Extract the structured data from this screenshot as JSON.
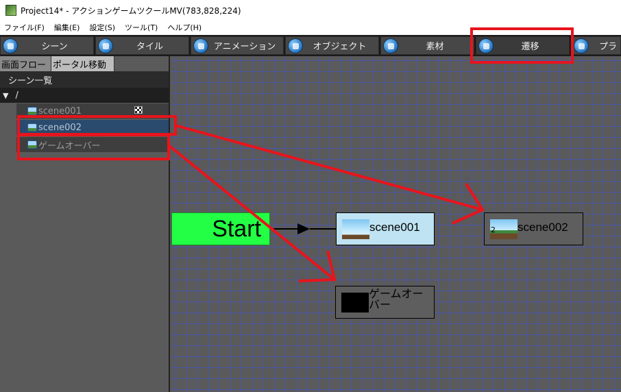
{
  "window": {
    "title": "Project14* - アクションゲームツクールMV(783,828,224)"
  },
  "menu": [
    "ファイル(F)",
    "編集(E)",
    "設定(S)",
    "ツール(T)",
    "ヘルプ(H)"
  ],
  "tabs": [
    {
      "label": "シーン",
      "icon": "scene-icon"
    },
    {
      "label": "タイル",
      "icon": "tile-icon"
    },
    {
      "label": "アニメーション",
      "icon": "animation-icon"
    },
    {
      "label": "オブジェクト",
      "icon": "object-icon"
    },
    {
      "label": "素材",
      "icon": "material-icon"
    },
    {
      "label": "遷移",
      "icon": "transition-icon"
    },
    {
      "label": "プラ",
      "icon": "plugin-icon"
    }
  ],
  "left_panel": {
    "subtabs": [
      "画面フロー",
      "ポータル移動"
    ],
    "header": "シーン一覧",
    "root": "/",
    "scenes": [
      "scene001",
      "scene002",
      "ゲームオーバー"
    ]
  },
  "canvas": {
    "start_label": "Start",
    "nodes": {
      "scene001": "scene001",
      "scene002": "scene002",
      "scene002_badge": "2",
      "gameover": "ゲームオーバー"
    }
  },
  "colors": {
    "annotation_red": "#e8141c",
    "start_green": "#22ff44",
    "grid_blue": "#4a56a8",
    "selected_row": "#2a4a6e"
  }
}
